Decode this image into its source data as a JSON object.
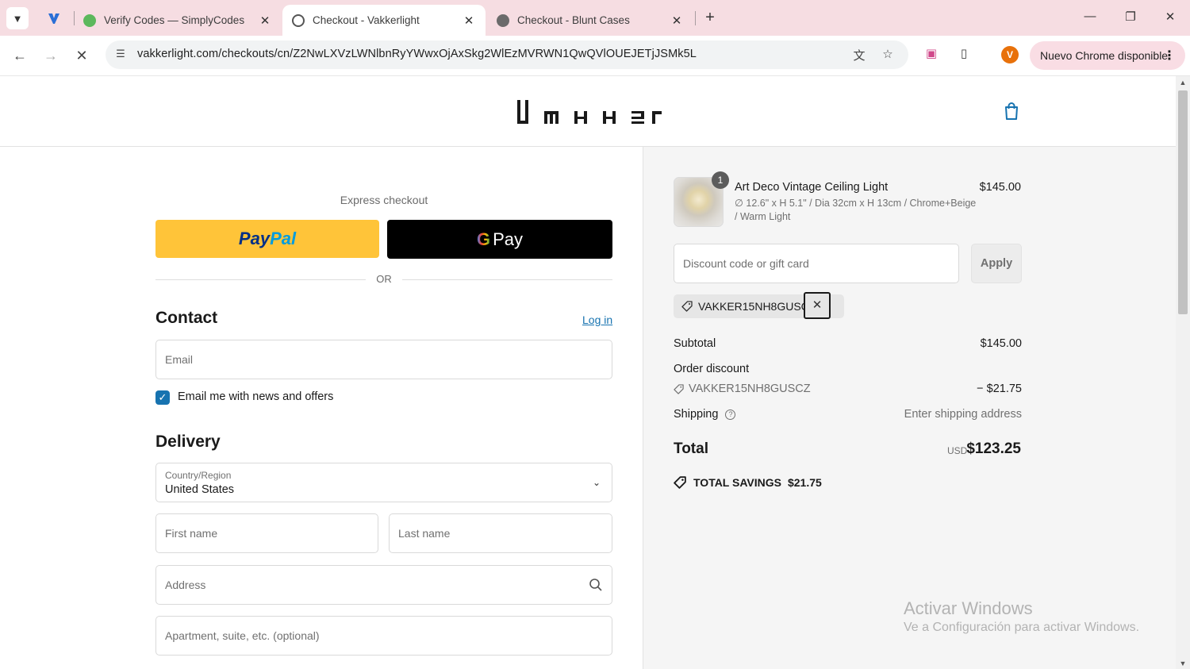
{
  "browser": {
    "tabs": [
      {
        "title": "Verify Codes — SimplyCodes",
        "active": false
      },
      {
        "title": "Checkout - Vakkerlight",
        "active": true
      },
      {
        "title": "Checkout - Blunt Cases",
        "active": false
      }
    ],
    "url": "vakkerlight.com/checkouts/cn/Z2NwLXVzLWNlbnRyYWwxOjAxSkg2WlEzMVRWN1QwQVlOUEJETjJSMk5L",
    "update_label": "Nuevo Chrome disponible",
    "profile_initial": "V",
    "colors": {
      "tabstrip": "#f6dde2",
      "profile": "#e8710a"
    }
  },
  "header": {
    "brand": "VAKKER",
    "icons": [
      "shopping-bag-icon"
    ]
  },
  "checkout": {
    "express_label": "Express checkout",
    "paypal": {
      "pay": "Pay",
      "pal": "Pal"
    },
    "gpay": {
      "g": "G",
      "pay": "Pay"
    },
    "or_label": "OR",
    "contact": {
      "heading": "Contact",
      "login_link": "Log in",
      "email_placeholder": "Email",
      "newsletter_label": "Email me with news and offers",
      "newsletter_checked": true
    },
    "delivery": {
      "heading": "Delivery",
      "country_label": "Country/Region",
      "country_value": "United States",
      "first_name_placeholder": "First name",
      "last_name_placeholder": "Last name",
      "address_placeholder": "Address",
      "apartment_placeholder": "Apartment, suite, etc. (optional)"
    },
    "accent_color": "#1773b0"
  },
  "order": {
    "item": {
      "quantity": "1",
      "name": "Art Deco Vintage Ceiling Light",
      "variant": "∅ 12.6\" x H 5.1\" / Dia 32cm x H 13cm / Chrome+Beige / Warm Light",
      "price": "$145.00"
    },
    "discount_placeholder": "Discount code or gift card",
    "apply_label": "Apply",
    "applied_code": "VAKKER15NH8GUSCZ",
    "subtotal_label": "Subtotal",
    "subtotal_value": "$145.00",
    "order_discount_label": "Order discount",
    "discount_code": "VAKKER15NH8GUSCZ",
    "discount_value": "− $21.75",
    "shipping_label": "Shipping",
    "shipping_value": "Enter shipping address",
    "total_label": "Total",
    "currency": "USD",
    "total_value": "$123.25",
    "savings_label": "TOTAL SAVINGS",
    "savings_value": "$21.75"
  },
  "watermark": {
    "title": "Activar Windows",
    "subtitle": "Ve a Configuración para activar Windows."
  }
}
